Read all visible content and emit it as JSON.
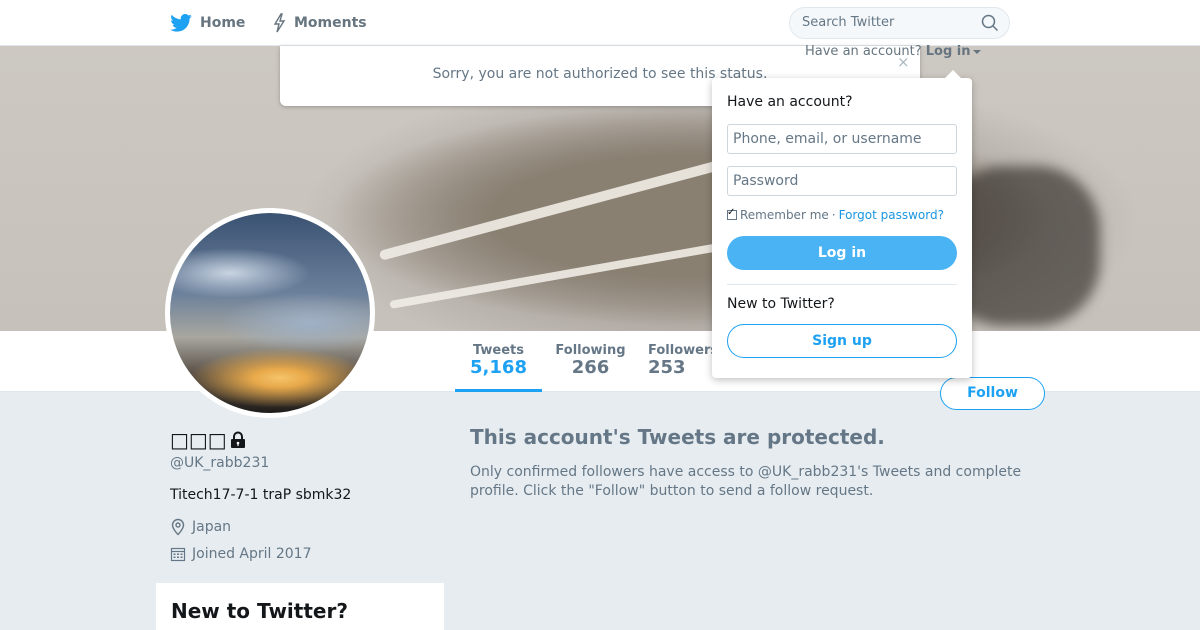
{
  "nav": {
    "home_label": "Home",
    "moments_label": "Moments",
    "search_placeholder": "Search Twitter"
  },
  "alert": {
    "text": "Sorry, you are not authorized to see this status.",
    "close": "×"
  },
  "login_toggle": {
    "prompt": "Have an account?",
    "link": "Log in"
  },
  "login_dropdown": {
    "heading": "Have an account?",
    "username_placeholder": "Phone, email, or username",
    "password_placeholder": "Password",
    "remember_label": "Remember me",
    "separator": "·",
    "forgot_label": "Forgot password?",
    "login_button": "Log in",
    "new_heading": "New to Twitter?",
    "signup_button": "Sign up"
  },
  "stats": {
    "tweets_label": "Tweets",
    "tweets_value": "5,168",
    "following_label": "Following",
    "following_value": "266",
    "followers_label": "Followers",
    "followers_value": "253"
  },
  "follow_button": "Follow",
  "profile": {
    "name": "□□□",
    "handle": "@UK_rabb231",
    "bio": "Titech17-7-1 traP sbmk32",
    "location": "Japan",
    "joined": "Joined April 2017"
  },
  "protected": {
    "title": "This account's Tweets are protected.",
    "text": "Only confirmed followers have access to @UK_rabb231's Tweets and complete profile. Click the \"Follow\" button to send a follow request."
  },
  "signup_card": {
    "title": "New to Twitter?"
  },
  "colors": {
    "accent": "#1da1f2",
    "background": "#e6ecf0",
    "muted_text": "#657786"
  },
  "icons": {
    "home": "twitter-bird-icon",
    "moments": "lightning-icon",
    "search": "search-icon",
    "lock": "lock-icon",
    "location": "location-pin-icon",
    "calendar": "calendar-icon"
  }
}
